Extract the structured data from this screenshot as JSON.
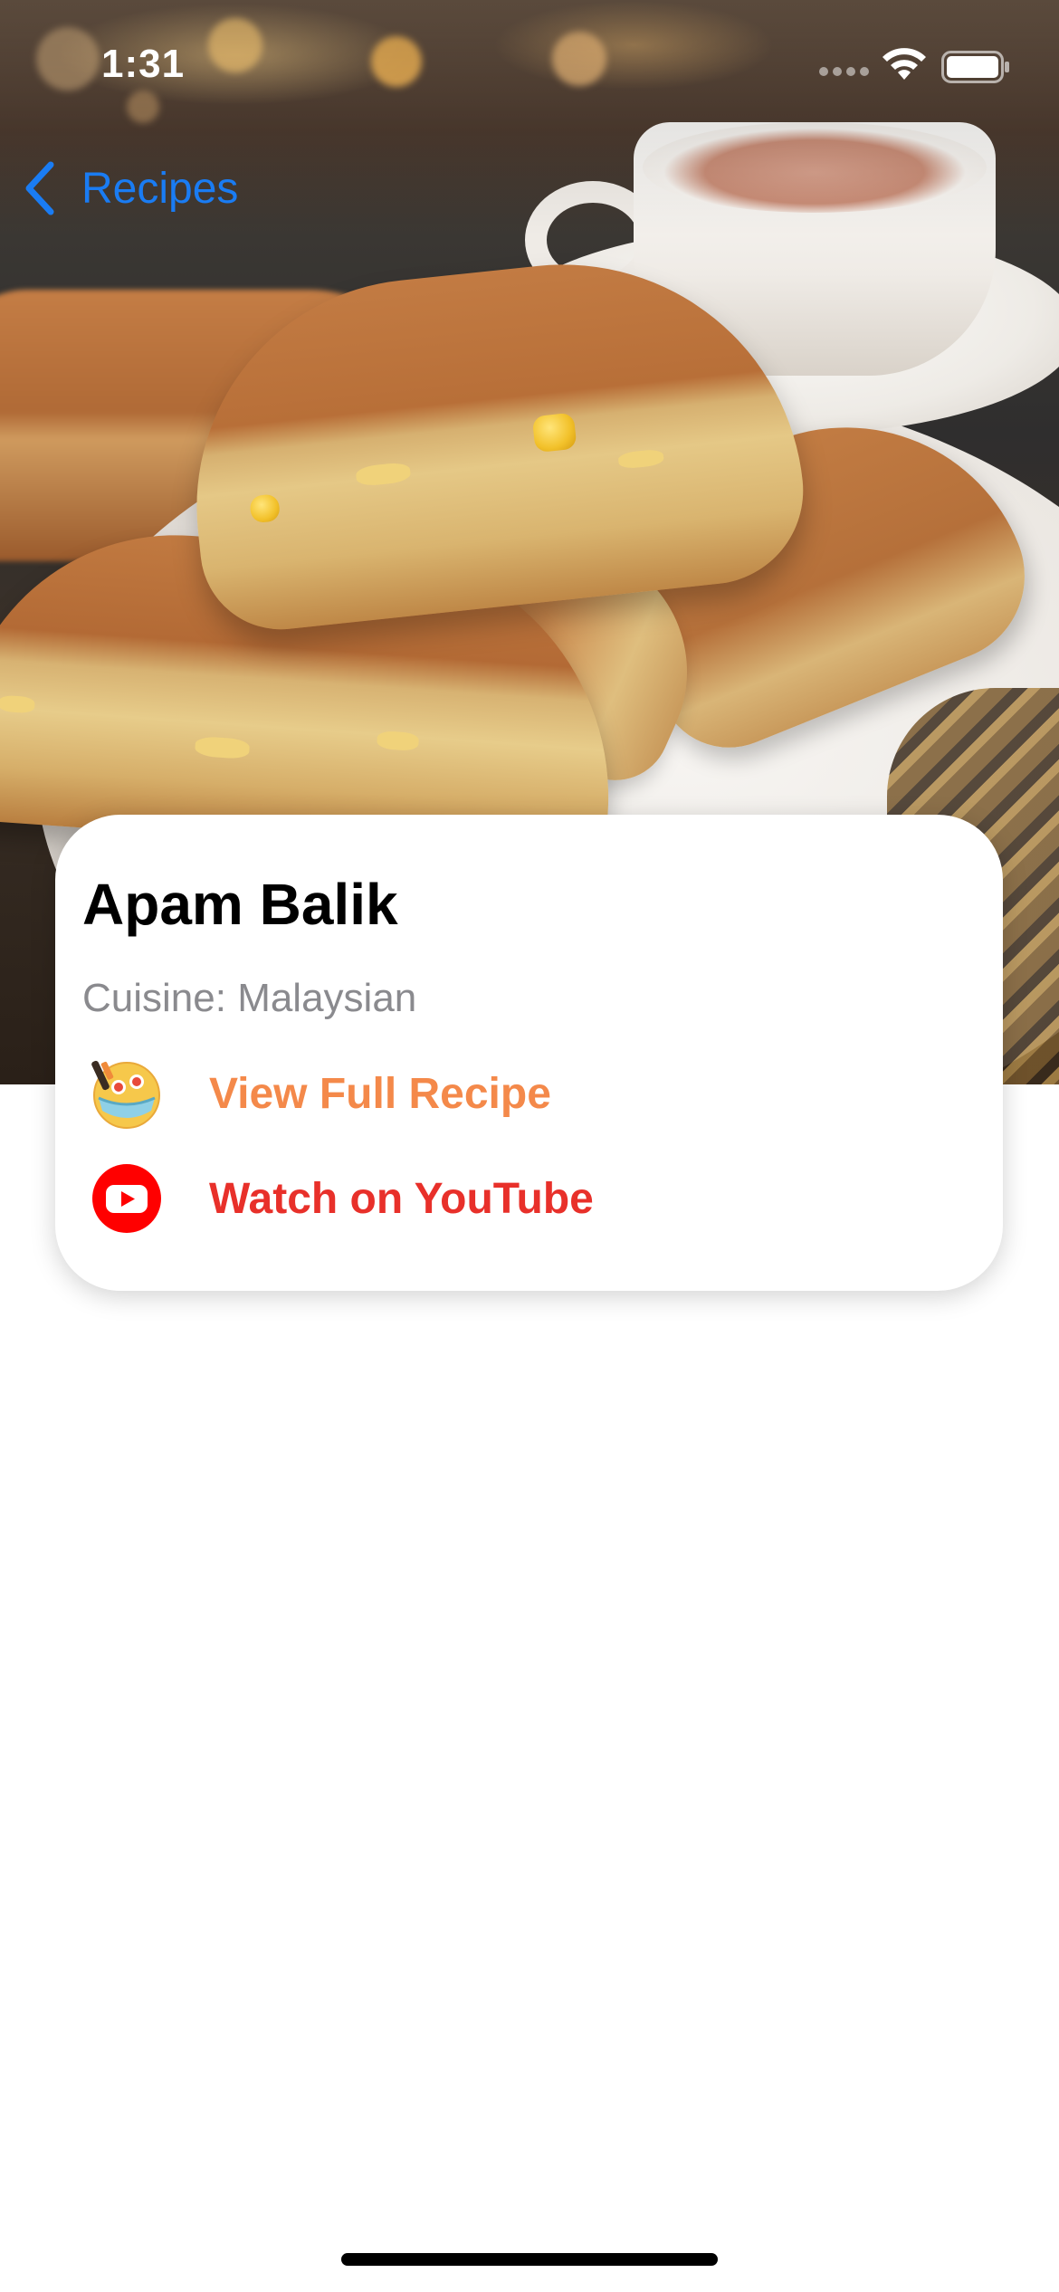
{
  "status_bar": {
    "time": "1:31"
  },
  "nav": {
    "back_label": "Recipes",
    "back_icon": "chevron-left-icon"
  },
  "recipe": {
    "title": "Apam Balik",
    "cuisine": "Cuisine: Malaysian"
  },
  "links": {
    "full_recipe": {
      "label": "View Full Recipe",
      "icon": "recipe-bowl-icon",
      "color": "#F4894A"
    },
    "youtube": {
      "label": "Watch on YouTube",
      "icon": "youtube-icon",
      "color": "#E8302A"
    }
  },
  "colors": {
    "accent_blue": "#1A7CF3",
    "secondary_text": "#8A8A8E",
    "card_background": "#FFFFFF"
  }
}
